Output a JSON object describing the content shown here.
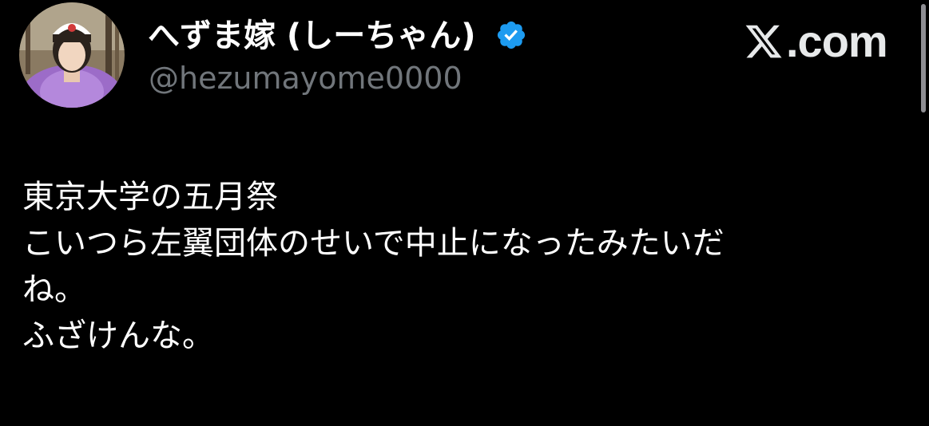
{
  "author": {
    "display_name": "へずま嫁 (しーちゃん)",
    "handle": "@hezumayome0000",
    "verified": true,
    "avatar_icon": "profile-photo"
  },
  "brand": {
    "label": ".com",
    "logo_icon": "x-logo-icon"
  },
  "tweet": {
    "lines": [
      "東京大学の五月祭",
      "こいつら左翼団体のせいで中止になったみたいだ",
      "ね。",
      "ふざけんな。"
    ]
  },
  "colors": {
    "background": "#000000",
    "text_primary": "#ffffff",
    "text_secondary": "#71767b",
    "verified_blue": "#1d9bf0"
  }
}
